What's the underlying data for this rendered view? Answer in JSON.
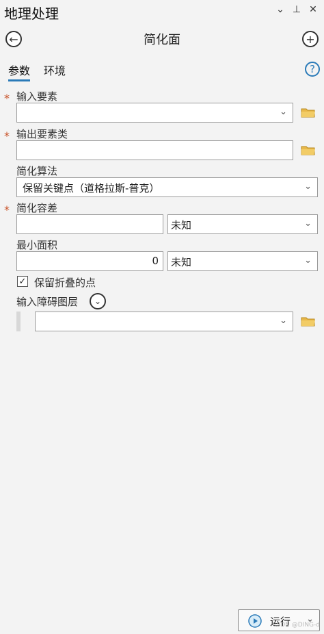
{
  "pane": {
    "title": "地理处理",
    "menu_glyph": "⌄",
    "pin_glyph": "⊥",
    "close_glyph": "✕"
  },
  "tool": {
    "title": "简化面",
    "back_glyph": "←",
    "add_glyph": "+"
  },
  "tabs": [
    {
      "label": "参数",
      "active": true
    },
    {
      "label": "环境",
      "active": false
    }
  ],
  "help_glyph": "?",
  "required_mark": "*",
  "fields": {
    "input_features": {
      "label": "输入要素",
      "value": ""
    },
    "output_features": {
      "label": "输出要素类",
      "value": ""
    },
    "algorithm": {
      "label": "简化算法",
      "value": "保留关键点（道格拉斯-普克）"
    },
    "tolerance": {
      "label": "简化容差",
      "value": "",
      "unit": "未知"
    },
    "min_area": {
      "label": "最小面积",
      "value": "0",
      "unit": "未知"
    },
    "keep_collapsed": {
      "label": "保留折叠的点",
      "checked": true,
      "check_glyph": "✓"
    },
    "barriers": {
      "label": "输入障碍图层",
      "value": ""
    }
  },
  "dropdown_glyph": "⌄",
  "run_button": {
    "label": "运行"
  },
  "watermark": "CSDN @DING-d"
}
